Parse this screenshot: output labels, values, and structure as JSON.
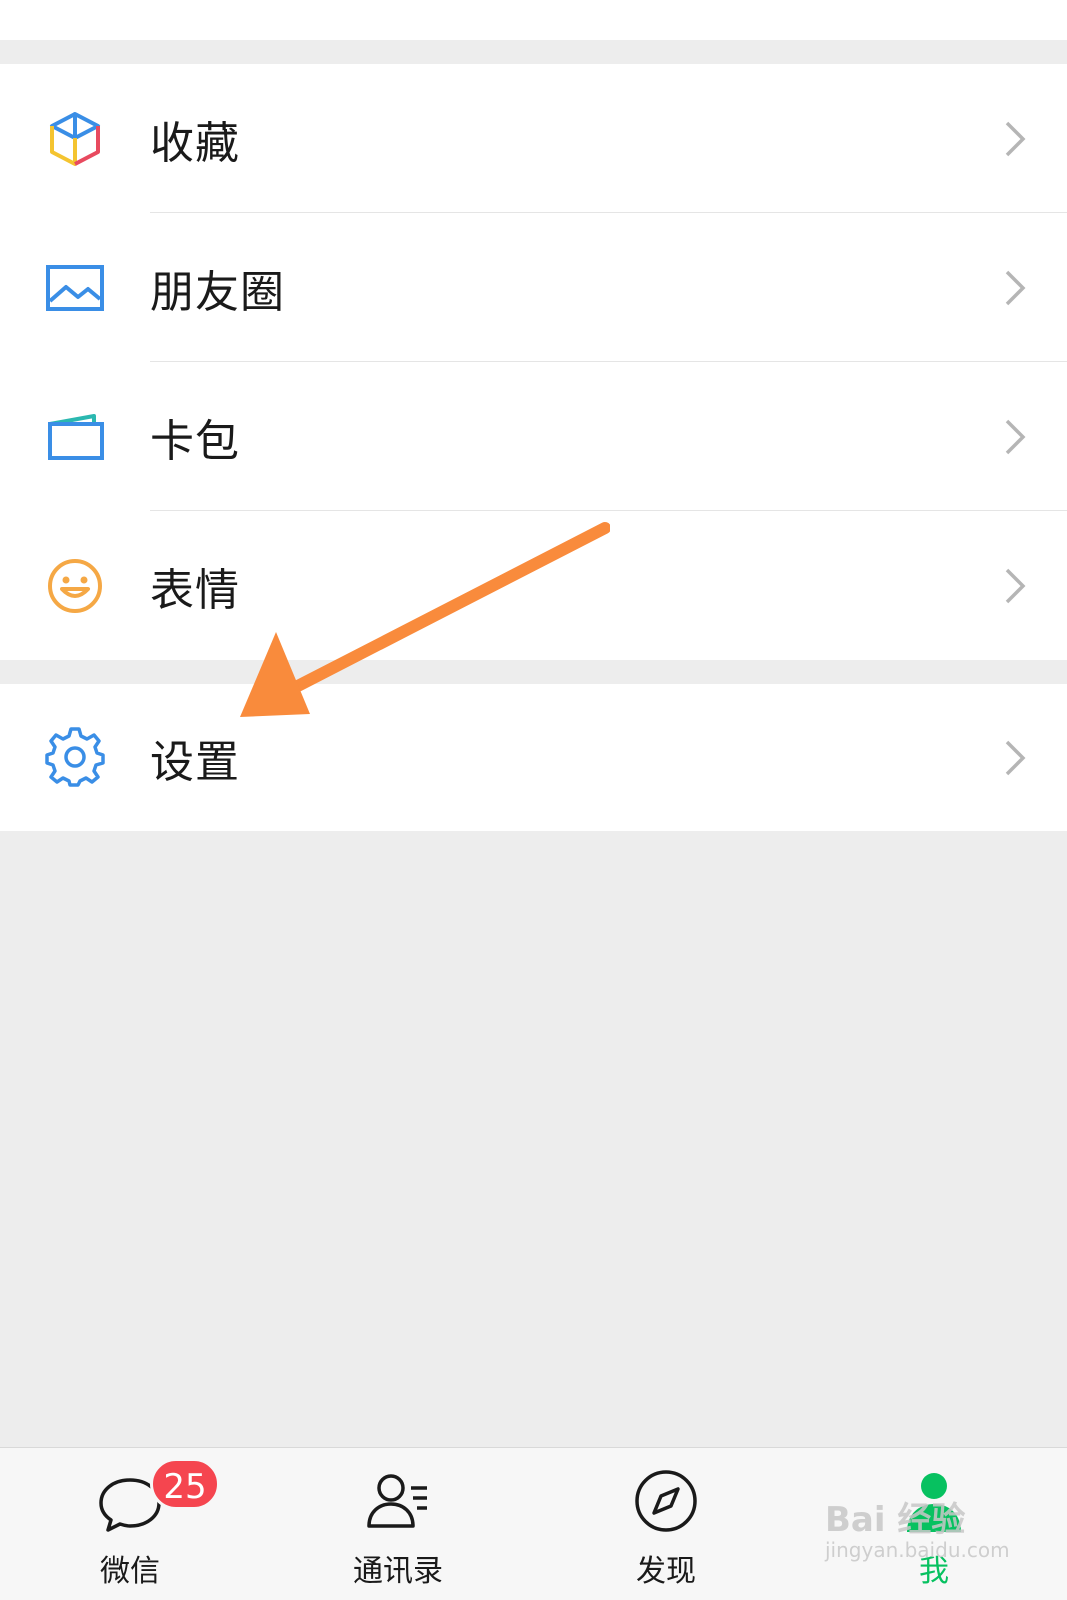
{
  "menu": {
    "items": [
      {
        "label": "收藏",
        "icon": "favorites-cube-icon"
      },
      {
        "label": "朋友圈",
        "icon": "moments-photo-icon"
      },
      {
        "label": "卡包",
        "icon": "card-wallet-icon"
      },
      {
        "label": "表情",
        "icon": "sticker-smiley-icon"
      }
    ],
    "settings": {
      "label": "设置",
      "icon": "gear-icon"
    }
  },
  "tabbar": {
    "tabs": [
      {
        "label": "微信",
        "icon": "chat-bubble-icon",
        "badge": "25",
        "active": false
      },
      {
        "label": "通讯录",
        "icon": "contacts-icon",
        "active": false
      },
      {
        "label": "发现",
        "icon": "compass-icon",
        "active": false
      },
      {
        "label": "我",
        "icon": "me-person-icon",
        "active": true
      }
    ]
  },
  "watermark": {
    "text": "Bai 经验",
    "sub": "jingyan.baidu.com"
  },
  "colors": {
    "accent_green": "#07c160",
    "badge_red": "#f5454f",
    "arrow_orange": "#f98b3c",
    "icon_blue": "#3a8ee6",
    "background": "#ededed"
  }
}
